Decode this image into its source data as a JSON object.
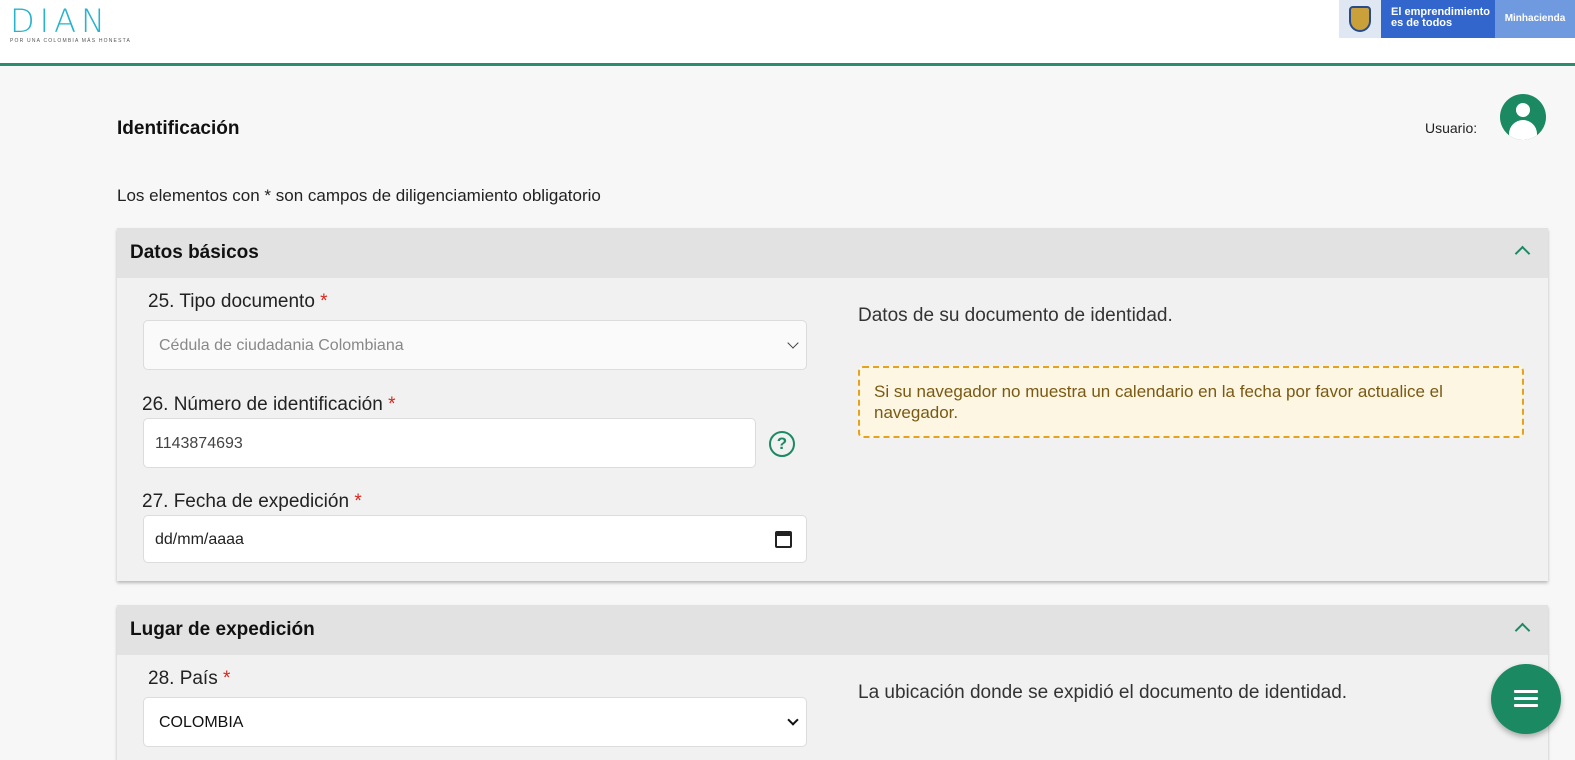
{
  "header": {
    "logo_text": "DIAN",
    "logo_tagline": "POR UNA COLOMBIA MÁS HONESTA",
    "gov_slogan_line1": "El emprendimiento",
    "gov_slogan_line2": "es de todos",
    "gov_ministry": "Minhacienda"
  },
  "page": {
    "title": "Identificación",
    "user_label": "Usuario:",
    "required_note": "Los elementos con * son campos de diligenciamiento obligatorio"
  },
  "datos_basicos": {
    "title": "Datos básicos",
    "tipo_documento": {
      "label": "25. Tipo documento",
      "required": "*",
      "value": "Cédula de ciudadania Colombiana"
    },
    "numero_identificacion": {
      "label": "26. Número de identificación",
      "required": "*",
      "value": "1143874693",
      "help": "?"
    },
    "fecha_expedicion": {
      "label": "27. Fecha de expedición",
      "required": "*",
      "value": "dd/mm/aaaa"
    },
    "description": "Datos de su documento de identidad.",
    "warning": "Si su navegador no muestra un calendario en la fecha por favor actualice el navegador."
  },
  "lugar_expedicion": {
    "title": "Lugar de expedición",
    "pais": {
      "label": "28. País",
      "required": "*",
      "value": "COLOMBIA"
    },
    "description": "La ubicación donde se expidió el documento de identidad."
  },
  "colors": {
    "primary_green": "#1b8a62",
    "header_accent": "#2e8b6e",
    "required_red": "#d9251c",
    "warning_border": "#e6a21c",
    "gov_blue": "#3366cc"
  },
  "icons": {
    "user": "user-circle-icon",
    "collapse": "chevron-up-icon",
    "help": "question-circle-icon",
    "calendar": "calendar-icon",
    "dropdown": "chevron-down-icon",
    "menu": "hamburger-menu-icon"
  }
}
